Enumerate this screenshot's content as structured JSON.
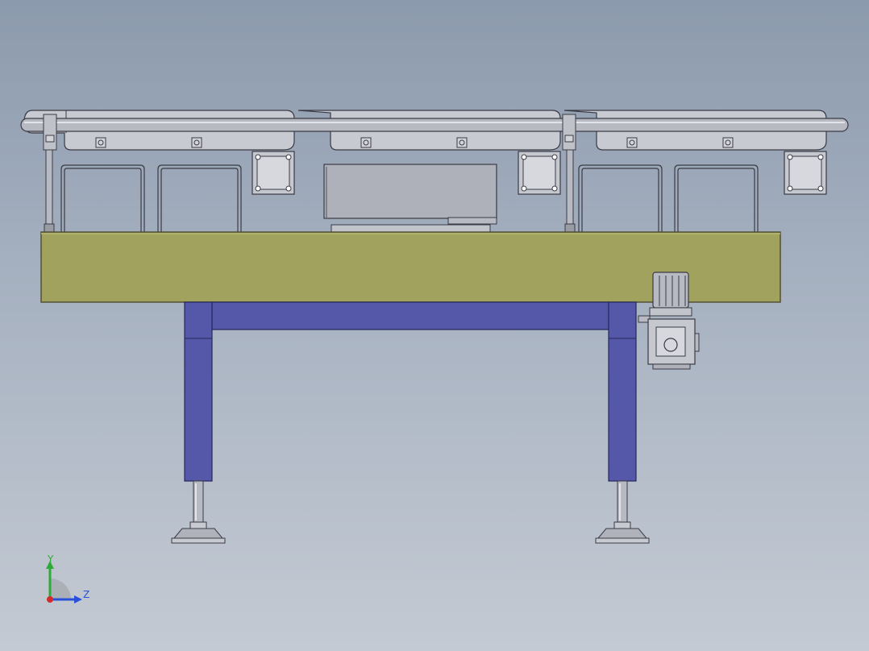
{
  "viewport": {
    "background_top": "#8c9aad",
    "background_bottom": "#c4cad3"
  },
  "colors": {
    "frame": "#a0a25d",
    "frame_edge": "#4a4a30",
    "legs": "#5557a8",
    "legs_dark": "#3f4190",
    "metal": "#b7bac3",
    "metal_light": "#d2d4da",
    "edge": "#3a3a44"
  },
  "triad": {
    "y_label": "Y",
    "z_label": "Z",
    "y_color": "#2eaa3a",
    "z_color": "#2a4fd8",
    "x_color": "#d42a2a"
  },
  "parts": {
    "conveyor_modules": 3,
    "guard_loops": 4,
    "support_legs": 2,
    "leveling_feet": 2
  }
}
